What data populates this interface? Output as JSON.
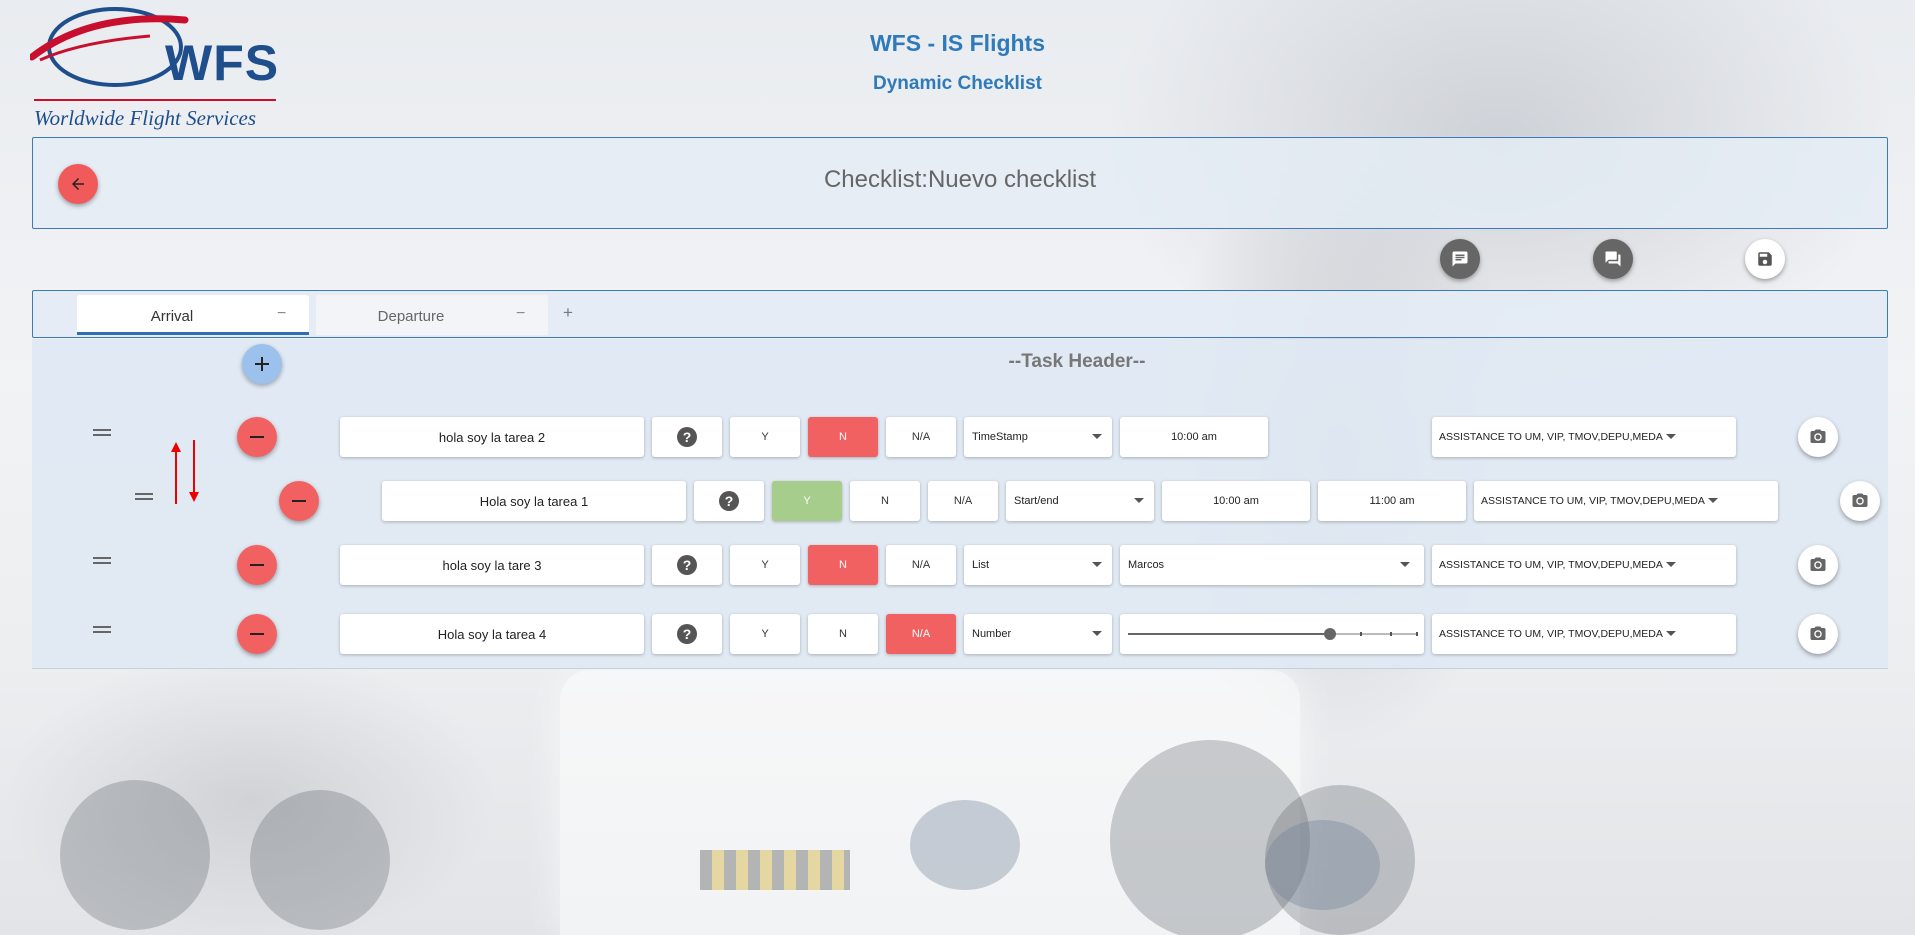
{
  "header": {
    "logo_text": "WFS",
    "logo_tagline": "Worldwide Flight Services",
    "app_title": "WFS - IS Flights",
    "app_subtitle": "Dynamic Checklist"
  },
  "checklist": {
    "title": "Checklist:Nuevo checklist"
  },
  "toolbar_icons": [
    "notes-icon",
    "comments-icon",
    "save-icon"
  ],
  "tabs": [
    {
      "label": "Arrival",
      "remove": "−",
      "active": true
    },
    {
      "label": "Departure",
      "remove": "−",
      "active": false
    }
  ],
  "tab_add": "+",
  "task_header": "--Task Header--",
  "yn_labels": {
    "yes": "Y",
    "no": "N",
    "na": "N/A"
  },
  "tasks": [
    {
      "name": "hola soy la tarea 2",
      "selected": "N",
      "type": "TimeStamp",
      "time_start": "10:00 am",
      "assistance": "ASSISTANCE TO UM, VIP, TMOV,DEPU,MEDA"
    },
    {
      "name": "Hola soy la tarea 1",
      "selected": "Y",
      "type": "Start/end",
      "time_start": "10:00 am",
      "time_end": "11:00 am",
      "assistance": "ASSISTANCE TO UM, VIP, TMOV,DEPU,MEDA"
    },
    {
      "name": "hola soy la tare 3",
      "selected": "N",
      "type": "List",
      "list_value": "Marcos",
      "assistance": "ASSISTANCE TO UM, VIP, TMOV,DEPU,MEDA"
    },
    {
      "name": "Hola soy la tarea 4",
      "selected": "N/A",
      "type": "Number",
      "slider_level": 0.7,
      "assistance": "ASSISTANCE TO UM, VIP, TMOV,DEPU,MEDA"
    }
  ],
  "colors": {
    "accent_blue": "#2f7ab9",
    "danger_red": "#f26161",
    "yes_green": "#a6cd8c",
    "add_blue": "#9cc1ec"
  }
}
